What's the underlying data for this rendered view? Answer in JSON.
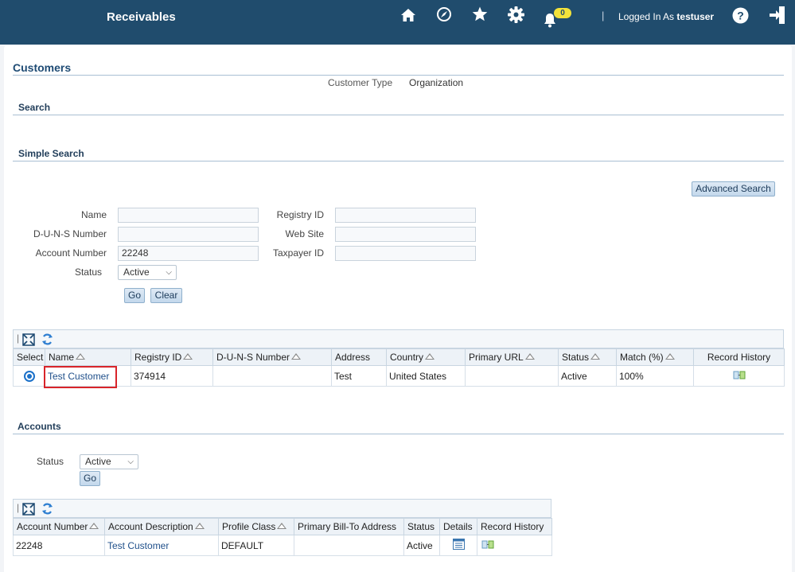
{
  "header": {
    "app_title": "Receivables",
    "notification_count": "0",
    "logged_in_prefix": "Logged In As",
    "username": "testuser",
    "icons": [
      "home-icon",
      "navigator-icon",
      "favorites-icon",
      "settings-icon",
      "notifications-icon",
      "help-icon",
      "sign-out-icon"
    ]
  },
  "page": {
    "title": "Customers",
    "customer_type_label": "Customer Type",
    "customer_type_value": "Organization"
  },
  "search": {
    "section_title": "Search",
    "simple_title": "Simple Search",
    "advanced_button": "Advanced Search",
    "name_label": "Name",
    "name_value": "",
    "duns_label": "D-U-N-S Number",
    "duns_value": "",
    "account_number_label": "Account Number",
    "account_number_value": "22248",
    "status_label": "Status",
    "status_value": "Active",
    "registry_label": "Registry ID",
    "registry_value": "",
    "website_label": "Web Site",
    "website_value": "",
    "taxpayer_label": "Taxpayer ID",
    "taxpayer_value": "",
    "go_button": "Go",
    "clear_button": "Clear"
  },
  "results": {
    "columns": [
      "Select",
      "Name",
      "Registry ID",
      "D-U-N-S Number",
      "Address",
      "Country",
      "Primary URL",
      "Status",
      "Match (%)",
      "Record History"
    ],
    "rows": [
      {
        "name": "Test Customer",
        "registry_id": "374914",
        "duns": "",
        "address": "Test",
        "country": "United States",
        "primary_url": "",
        "status": "Active",
        "match": "100%"
      }
    ]
  },
  "accounts": {
    "section_title": "Accounts",
    "status_label": "Status",
    "status_value": "Active",
    "go_button": "Go",
    "columns": [
      "Account Number",
      "Account Description",
      "Profile Class",
      "Primary Bill-To Address",
      "Status",
      "Details",
      "Record History"
    ],
    "rows": [
      {
        "account_number": "22248",
        "description": "Test Customer",
        "profile_class": "DEFAULT",
        "bill_to": "",
        "status": "Active"
      }
    ]
  },
  "colors": {
    "header_bg": "#204c6d",
    "highlight_box": "#d8242a",
    "link": "#1f4f8a"
  }
}
